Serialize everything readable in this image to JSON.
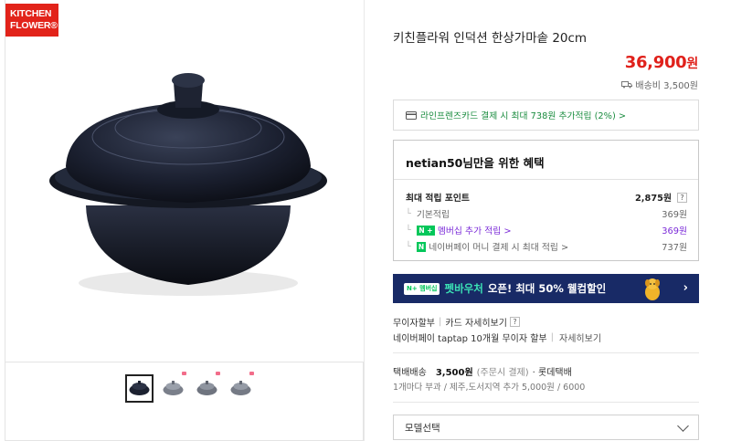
{
  "brand": {
    "logo_line1": "KITCHEN",
    "logo_line2": "FLOWER®",
    "color": "#e2231a"
  },
  "gallery": {
    "thumbnail_count": 4,
    "selected_index": 0
  },
  "product": {
    "title": "키친플라워 인덕션 한상가마솥 20cm",
    "price": "36,900",
    "price_unit": "원",
    "shipping_fee": "배송비 3,500원"
  },
  "card_promo": {
    "text": "라인프렌즈카드 결제 시 최대 738원 추가적립 (2%) >"
  },
  "benefit": {
    "title": "netian50님만을 위한 혜택",
    "max_points_label": "최대 적립 포인트",
    "max_points_value": "2,875원",
    "help": "?",
    "rows": [
      {
        "label": "기본적립",
        "value": "369원"
      },
      {
        "label": "멤버십 추가 적립 >",
        "value": "369원",
        "badge": "N +"
      },
      {
        "label": "네이버페이 머니 결제 시 최대 적립 >",
        "value": "737원",
        "badge": "N"
      }
    ]
  },
  "banner": {
    "tag": "N+ 멤버십",
    "text_hl": "펫바우처",
    "text": "오픈! 최대 50% 웰컴할인",
    "bg": "#182a66"
  },
  "installment": {
    "label": "무이자할부",
    "card_detail": "카드 자세히보기",
    "help": "?",
    "line2": "네이버페이 taptap 10개월 무이자 할부",
    "line2_link": "자세히보기"
  },
  "delivery": {
    "label": "택배배송",
    "fee": "3,500원",
    "note": "(주문시 결제)",
    "carrier": "· 롯데택배",
    "extra": "1개마다 부과 / 제주,도서지역 추가 5,000원 / 6000"
  },
  "option": {
    "placeholder": "모델선택"
  }
}
